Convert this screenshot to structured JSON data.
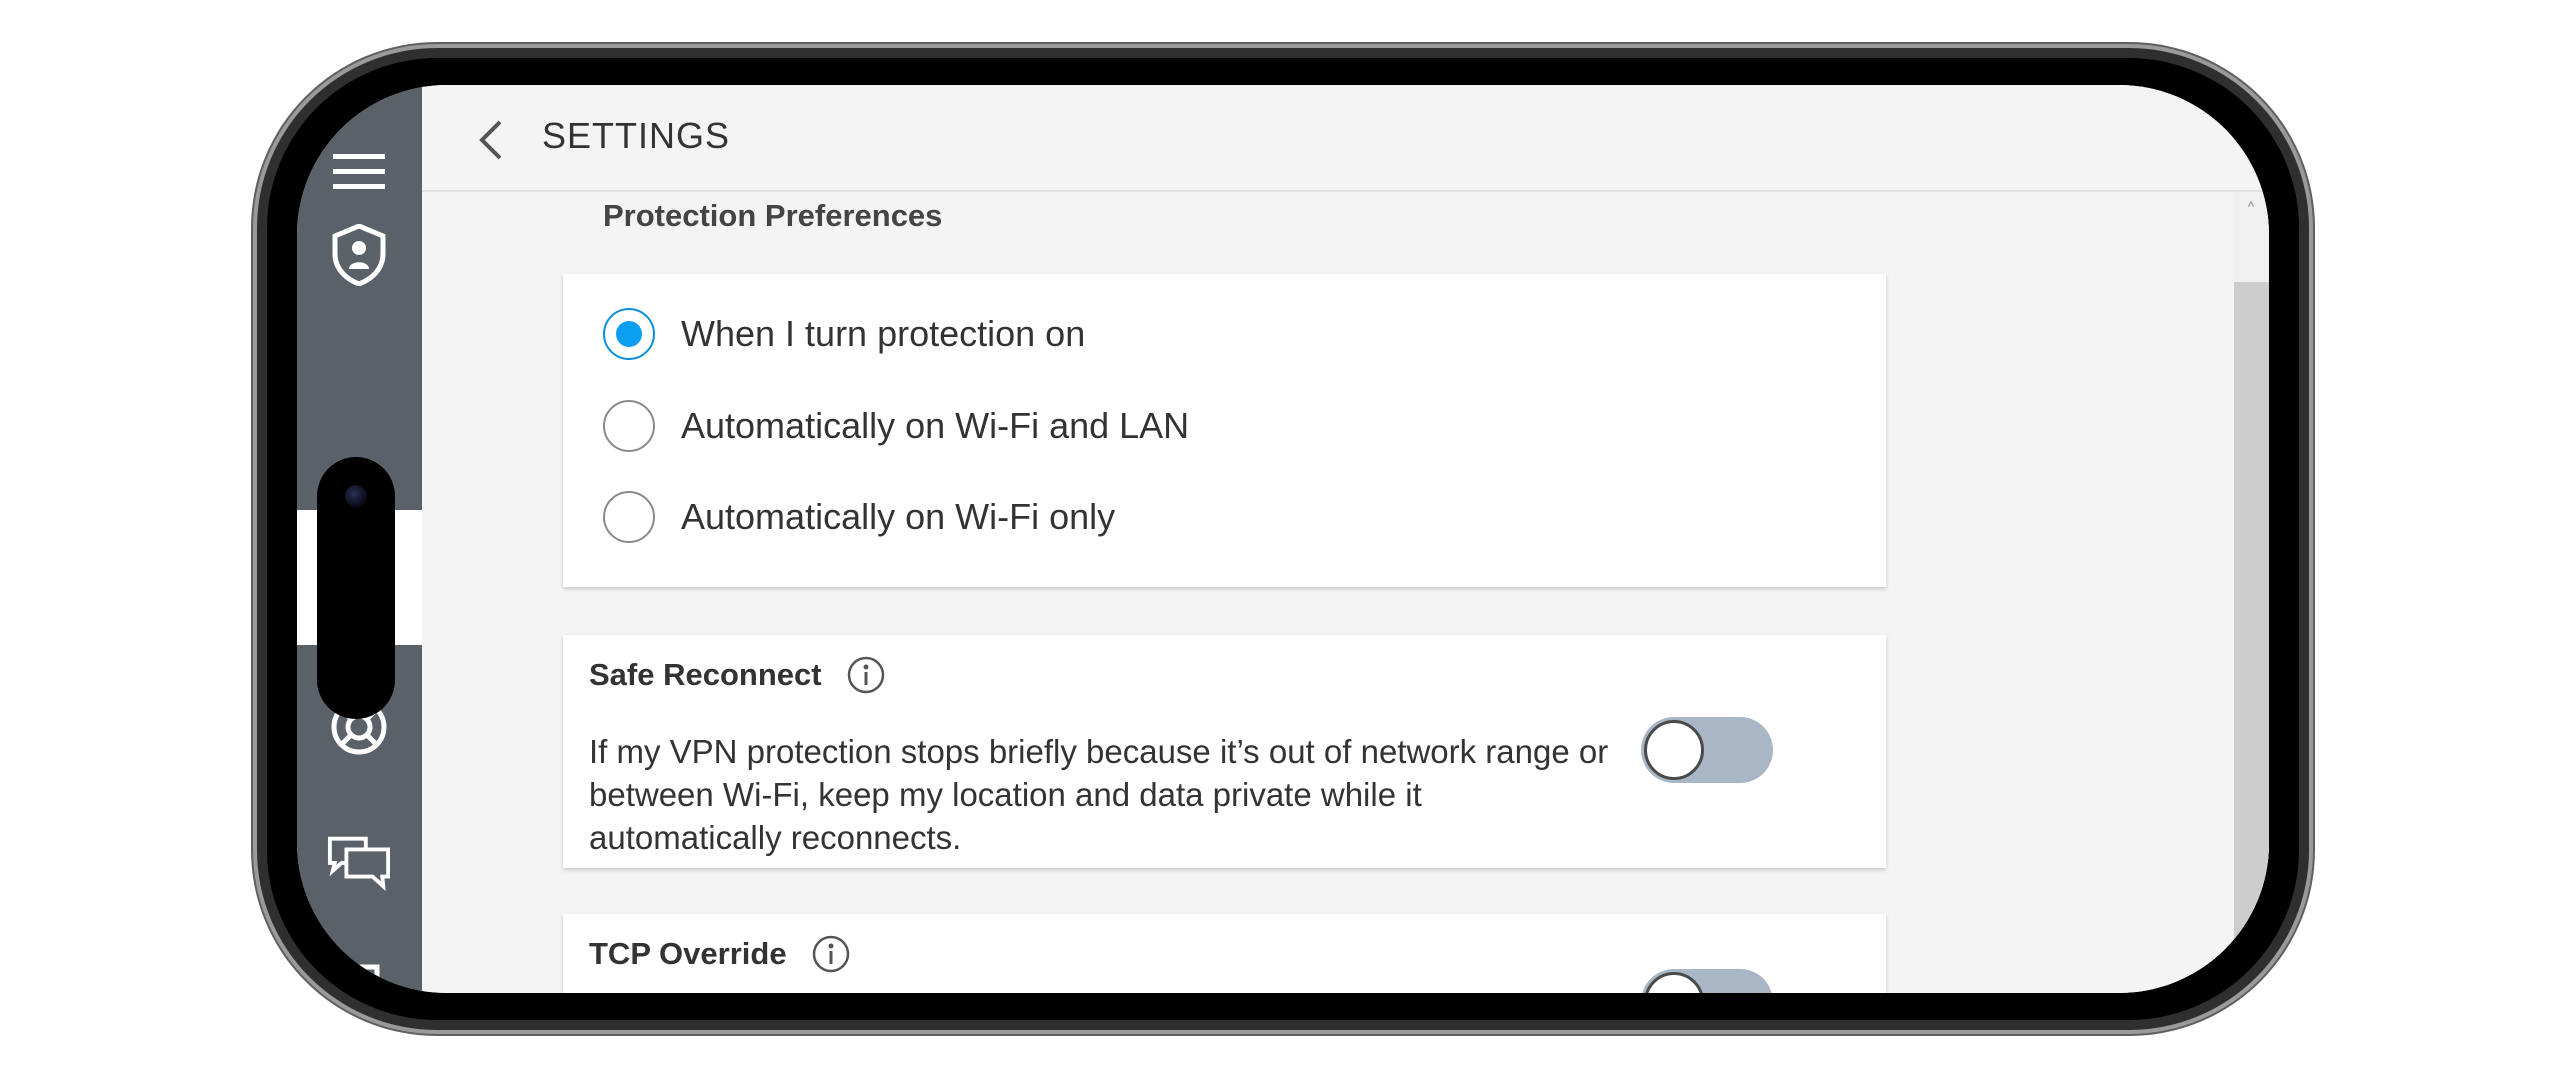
{
  "header": {
    "title": "SETTINGS",
    "back_icon": "chevron-left-icon"
  },
  "sidebar": {
    "items": [
      {
        "icon": "hamburger-menu-icon"
      },
      {
        "icon": "shield-user-icon"
      },
      {
        "icon": "lifebuoy-icon"
      },
      {
        "icon": "chat-bubbles-icon"
      },
      {
        "icon": "exit-icon"
      }
    ]
  },
  "protection": {
    "section_label": "Protection Preferences",
    "options": [
      {
        "label": "When I turn protection on",
        "selected": true
      },
      {
        "label": "Automatically on Wi-Fi and LAN",
        "selected": false
      },
      {
        "label": "Automatically on Wi-Fi only",
        "selected": false
      }
    ]
  },
  "safe_reconnect": {
    "title": "Safe Reconnect",
    "description": "If my VPN protection stops briefly because it’s out of network range or between Wi-Fi, keep my location and data private while it automatically reconnects.",
    "enabled": false
  },
  "tcp_override": {
    "title": "TCP Override",
    "enabled": false
  },
  "colors": {
    "sidebar": "#5a6169",
    "accent": "#0b9ef0",
    "toggle_off": "#a9b6c6",
    "background": "#f4f4f4"
  }
}
